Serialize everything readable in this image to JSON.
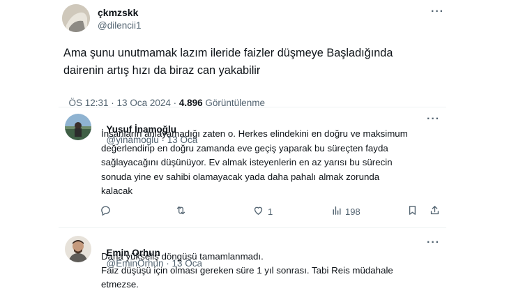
{
  "main_tweet": {
    "display_name": "çkmzskk",
    "handle": "@dilencii1",
    "text_line1": "Ama şunu unutmamak lazım ileride faizler düşmeye  Başladığında",
    "text_line2": "dairenin artış hızı da biraz can yakabilir",
    "time": "ÖS 12:31 · 13 Oca 2024 · ",
    "views_count": "4.896",
    "views_label": " Görüntülenme"
  },
  "replies": [
    {
      "display_name": "Yusuf İnamoğlu",
      "handle": "@yinamoglu",
      "separator": " · ",
      "date": "13 Oca",
      "lines": [
        "İnsanların anlayamadığı zaten o. Herkes elindekini en doğru ve maksimum",
        "değerlendirip en doğru zamanda eve geçiş yaparak bu süreçten fayda",
        "sağlayacağını düşünüyor. Ev almak isteyenlerin en az yarısı bu sürecin",
        "sonuda yine ev sahibi olamayacak yada daha pahalı almak zorunda",
        "kalacak"
      ],
      "actions": {
        "reply_icon": "reply-icon",
        "retweet_icon": "retweet-icon",
        "like_icon": "heart-icon",
        "like_count": "1",
        "views_icon": "views-icon",
        "views_count": "198",
        "bookmark_icon": "bookmark-icon",
        "share_icon": "share-icon"
      }
    },
    {
      "display_name": "Emin Orhun",
      "handle": "@EminOrhun",
      "separator": " · ",
      "date": "13 Oca",
      "lines": [
        "Daha yükseliş döngüsü tamamlanmadı.",
        "Faiz düşüşü için olması gereken süre 1 yıl sonrası. Tabi Reis müdahale",
        "etmezse."
      ]
    }
  ],
  "more_glyph": "···",
  "colors": {
    "text": "#0f1419",
    "muted": "#536471",
    "divider": "#eff3f4"
  }
}
